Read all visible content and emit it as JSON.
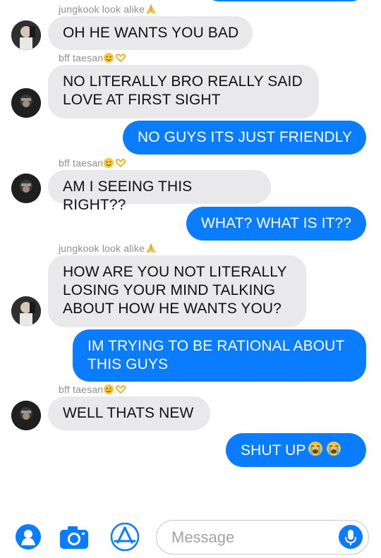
{
  "thread": {
    "messages": [
      {
        "sender": "jungkook look alike",
        "sender_emoji": "pray",
        "direction": "in",
        "text": "OH HE WANTS YOU BAD"
      },
      {
        "sender": "bff taesan",
        "sender_emoji": "smile-heart-hands",
        "direction": "in",
        "text": "NO LITERALLY BRO REALLY SAID LOVE AT FIRST SIGHT"
      },
      {
        "direction": "out",
        "text": "NO GUYS ITS JUST FRIENDLY"
      },
      {
        "sender": "bff taesan",
        "sender_emoji": "smile-heart-hands",
        "direction": "in",
        "text": "AM I SEEING THIS RIGHT??"
      },
      {
        "direction": "out",
        "text": "WHAT? WHAT IS IT??"
      },
      {
        "sender": "jungkook look alike",
        "sender_emoji": "pray",
        "direction": "in",
        "text": "HOW ARE YOU NOT LITERALLY LOSING YOUR MIND TALKING ABOUT HOW HE WANTS YOU?"
      },
      {
        "direction": "out",
        "text": "IM TRYING TO BE RATIONAL ABOUT THIS GUYS"
      },
      {
        "sender": "bff taesan",
        "sender_emoji": "smile-heart-hands",
        "direction": "in",
        "text": "WELL THATS NEW"
      },
      {
        "direction": "out",
        "text": "SHUT UP",
        "trailing_emoji": "crying-faces"
      }
    ]
  },
  "composer": {
    "placeholder": "Message"
  },
  "icons": {
    "contact": "contact-icon",
    "camera": "camera-icon",
    "appstore": "appstore-icon",
    "mic": "microphone-icon"
  },
  "colors": {
    "outgoing": "#0a7cff",
    "incoming": "#e9e9eb",
    "label": "#8e8e93"
  }
}
